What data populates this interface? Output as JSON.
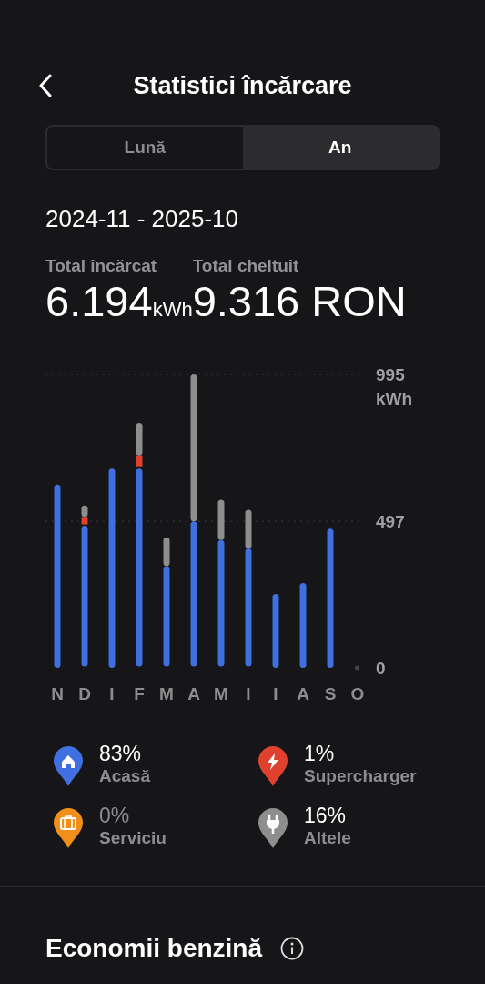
{
  "header": {
    "title": "Statistici încărcare"
  },
  "tabs": [
    {
      "label": "Lună",
      "selected": false
    },
    {
      "label": "An",
      "selected": true
    }
  ],
  "period": "2024-11 - 2025-10",
  "totals": [
    {
      "label": "Total încărcat",
      "value": "6.194",
      "unit": "kWh"
    },
    {
      "label": "Total cheltuit",
      "value": "9.316 RON"
    }
  ],
  "chart_data": {
    "type": "bar",
    "stacked": true,
    "ylabel": "kWh",
    "categories": [
      "N",
      "D",
      "I",
      "F",
      "M",
      "A",
      "M",
      "I",
      "I",
      "A",
      "S",
      "O"
    ],
    "ylim": [
      0,
      995
    ],
    "yticks": [
      0,
      497,
      995
    ],
    "series": [
      {
        "color": "#3f6fe0",
        "values": [
          622,
          482,
          676,
          676,
          345,
          497,
          433,
          405,
          250,
          287,
          472,
          0
        ]
      },
      {
        "color": "#e0402e",
        "values": [
          0,
          30,
          0,
          45,
          0,
          0,
          0,
          0,
          0,
          0,
          0,
          0
        ]
      },
      {
        "color": "#8e8e8e",
        "values": [
          0,
          39,
          0,
          110,
          98,
          498,
          137,
          131,
          0,
          0,
          0,
          0
        ]
      }
    ]
  },
  "legend": [
    {
      "kind": "home",
      "color": "#3f6fe0",
      "percent": "83%",
      "label": "Acasă",
      "muted": false
    },
    {
      "kind": "bolt",
      "color": "#e0402e",
      "percent": "1%",
      "label": "Supercharger",
      "muted": false
    },
    {
      "kind": "briefcase",
      "color": "#f0901a",
      "percent": "0%",
      "label": "Serviciu",
      "muted": true
    },
    {
      "kind": "plug",
      "color": "#8e8e8e",
      "percent": "16%",
      "label": "Altele",
      "muted": false
    }
  ],
  "section": {
    "title": "Economii benzină"
  }
}
